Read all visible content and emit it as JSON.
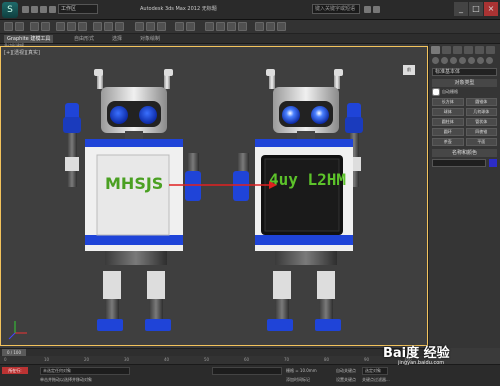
{
  "title_bar": {
    "logo": "3ds-max-logo",
    "workspace": "工作区",
    "title": "Autodesk 3ds Max 2012  无标题",
    "search_placeholder": "键入关键字或短语"
  },
  "ribbon": {
    "tabs": [
      "Graphite 建模工具",
      "自由形式",
      "选择",
      "对象绘制"
    ],
    "active_index": 0
  },
  "toolbar_row2": {
    "label": "多边形建模"
  },
  "viewport": {
    "label": "[+][透视][真实]",
    "viewcube_label": "前",
    "left_robot_screen_text": "MHSJS",
    "right_robot_screen_text": "4uy L2HM",
    "accent_blue": "#1f44d8",
    "arrow_color": "#e02020"
  },
  "command_panel": {
    "category": "标准基本体",
    "object_type_rollout": "对象类型",
    "autogrid_label": "自动栅格",
    "buttons": [
      "长方体",
      "圆锥体",
      "球体",
      "几何球体",
      "圆柱体",
      "管状体",
      "圆环",
      "四棱锥",
      "茶壶",
      "平面"
    ],
    "name_color_rollout": "名称和颜色",
    "color_swatch": "#2c2cc8"
  },
  "timeline": {
    "slider_label": "0 / 100",
    "ruler_ticks": [
      "0",
      "10",
      "20",
      "30",
      "40",
      "50",
      "60",
      "70",
      "80",
      "90",
      "100"
    ]
  },
  "status_bar": {
    "selection_info": "未选定任何对象",
    "prompt": "单击并拖动以选择并移动对象",
    "maxscript_label": "所在行:",
    "add_time_tag": "添加时间标记",
    "grid_value": "栅格 = 10.0mm",
    "auto_key": "自动关键点",
    "selected_option": "选定对象",
    "set_key": "设置关键点",
    "key_filter": "关键点过滤器..."
  },
  "watermark": {
    "brand": "Bai度 经验",
    "sub": "jingyan.baidu.com"
  }
}
